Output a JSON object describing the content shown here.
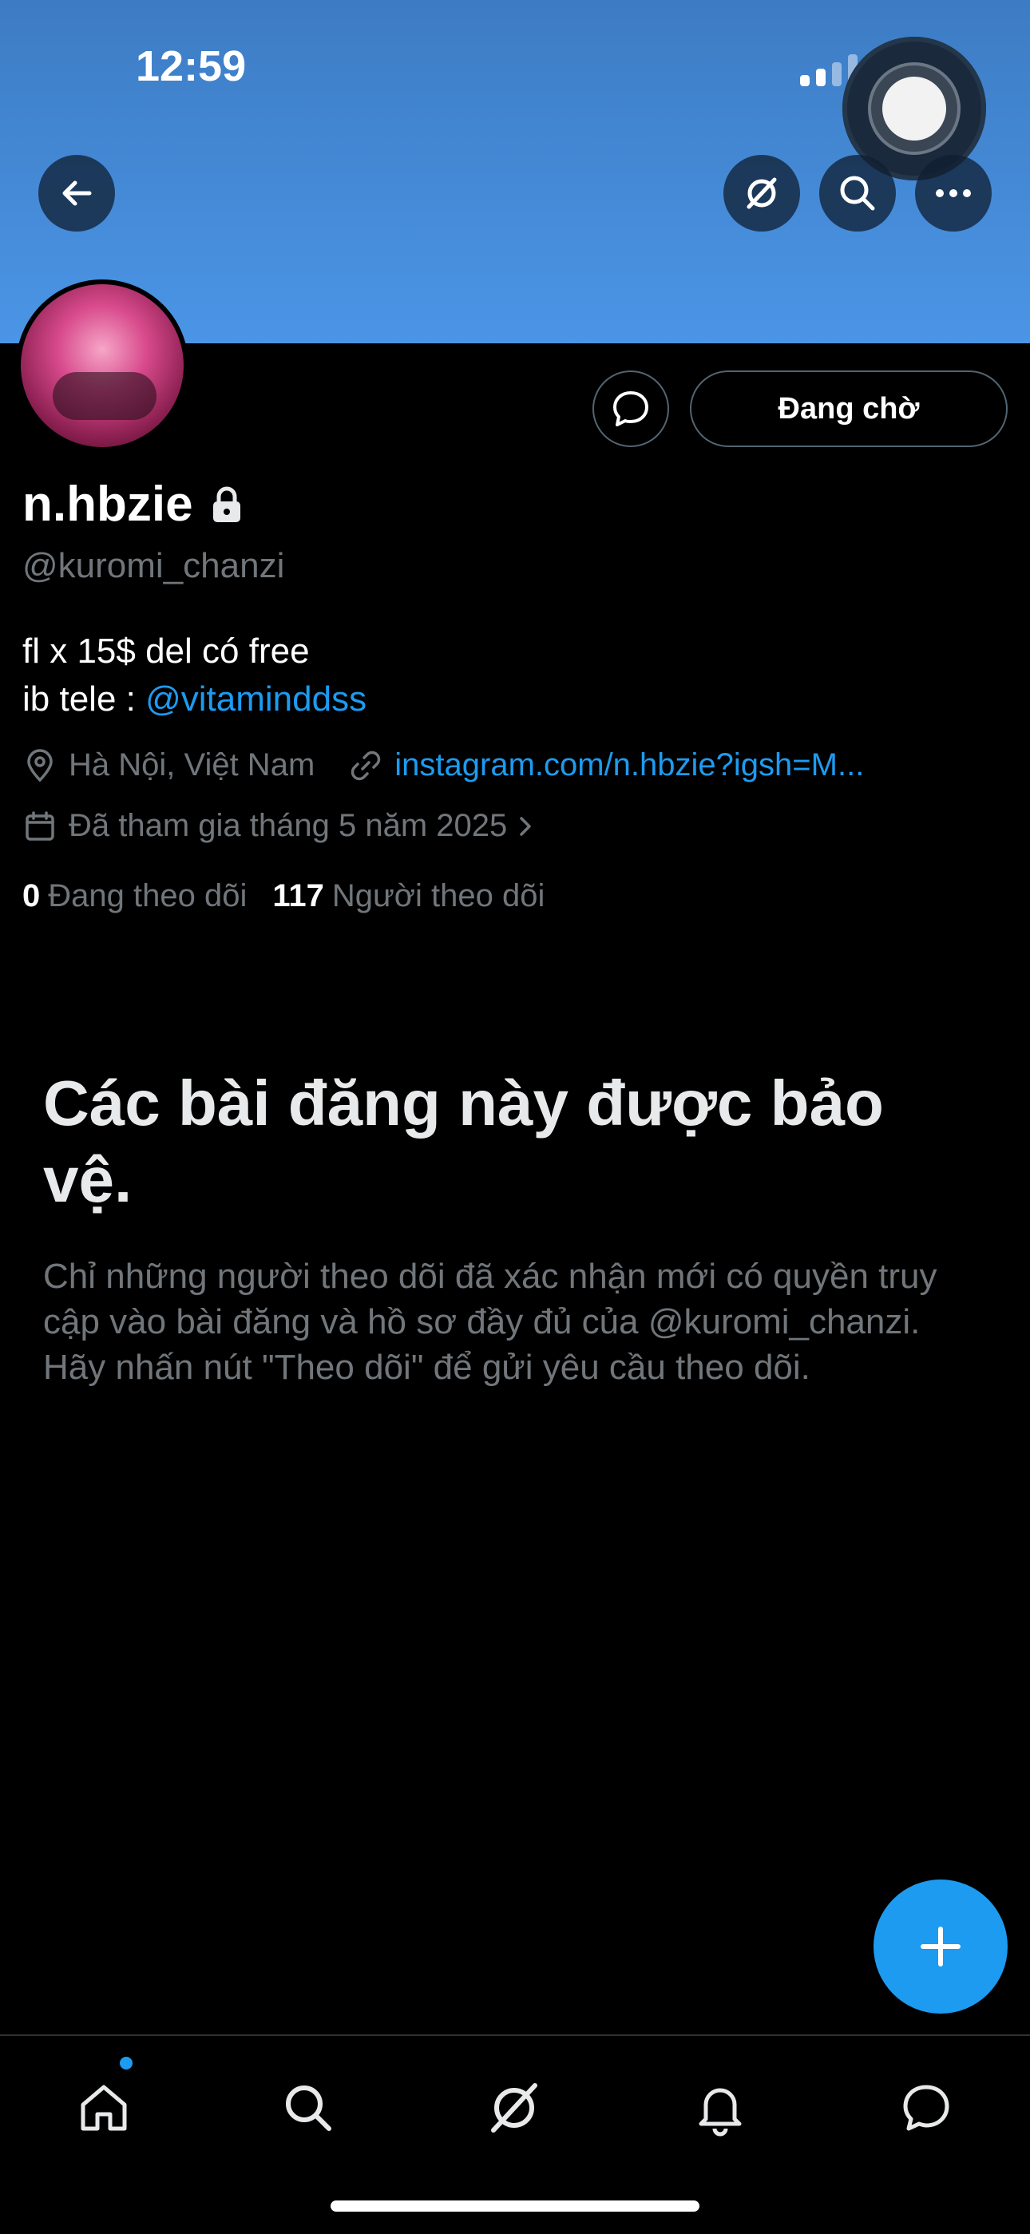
{
  "status_bar": {
    "time": "12:59"
  },
  "header": {
    "back_icon": "arrow-left-icon",
    "grok_icon": "grok-icon",
    "search_icon": "search-icon",
    "more_icon": "more-icon"
  },
  "profile": {
    "display_name": "n.hbzie",
    "handle": "@kuromi_chanzi",
    "bio_line1": "fl x 15$ del có free",
    "bio_line2_prefix": "ib tele : ",
    "bio_line2_link": "@vitaminddss",
    "location": "Hà Nội, Việt Nam",
    "website": "instagram.com/n.hbzie?igsh=M...",
    "joined": "Đã tham gia tháng 5 năm 2025",
    "following_count": "0",
    "following_label": "Đang theo dõi",
    "followers_count": "117",
    "followers_label": "Người theo dõi",
    "pending_button": "Đang chờ"
  },
  "protected": {
    "title": "Các bài đăng này được bảo vệ.",
    "description": "Chỉ những người theo dõi đã xác nhận mới có quyền truy cập vào bài đăng và hồ sơ đầy đủ của @kuromi_chanzi. Hãy nhấn nút \"Theo dõi\" để gửi yêu cầu theo dõi."
  },
  "nav": {
    "items": [
      "home-icon",
      "search-icon",
      "grok-icon",
      "bell-icon",
      "messages-icon"
    ]
  },
  "colors": {
    "accent": "#1d9bf0",
    "banner_top": "#3d7cc4",
    "banner_bottom": "#4b95e6",
    "muted": "#71767b"
  }
}
